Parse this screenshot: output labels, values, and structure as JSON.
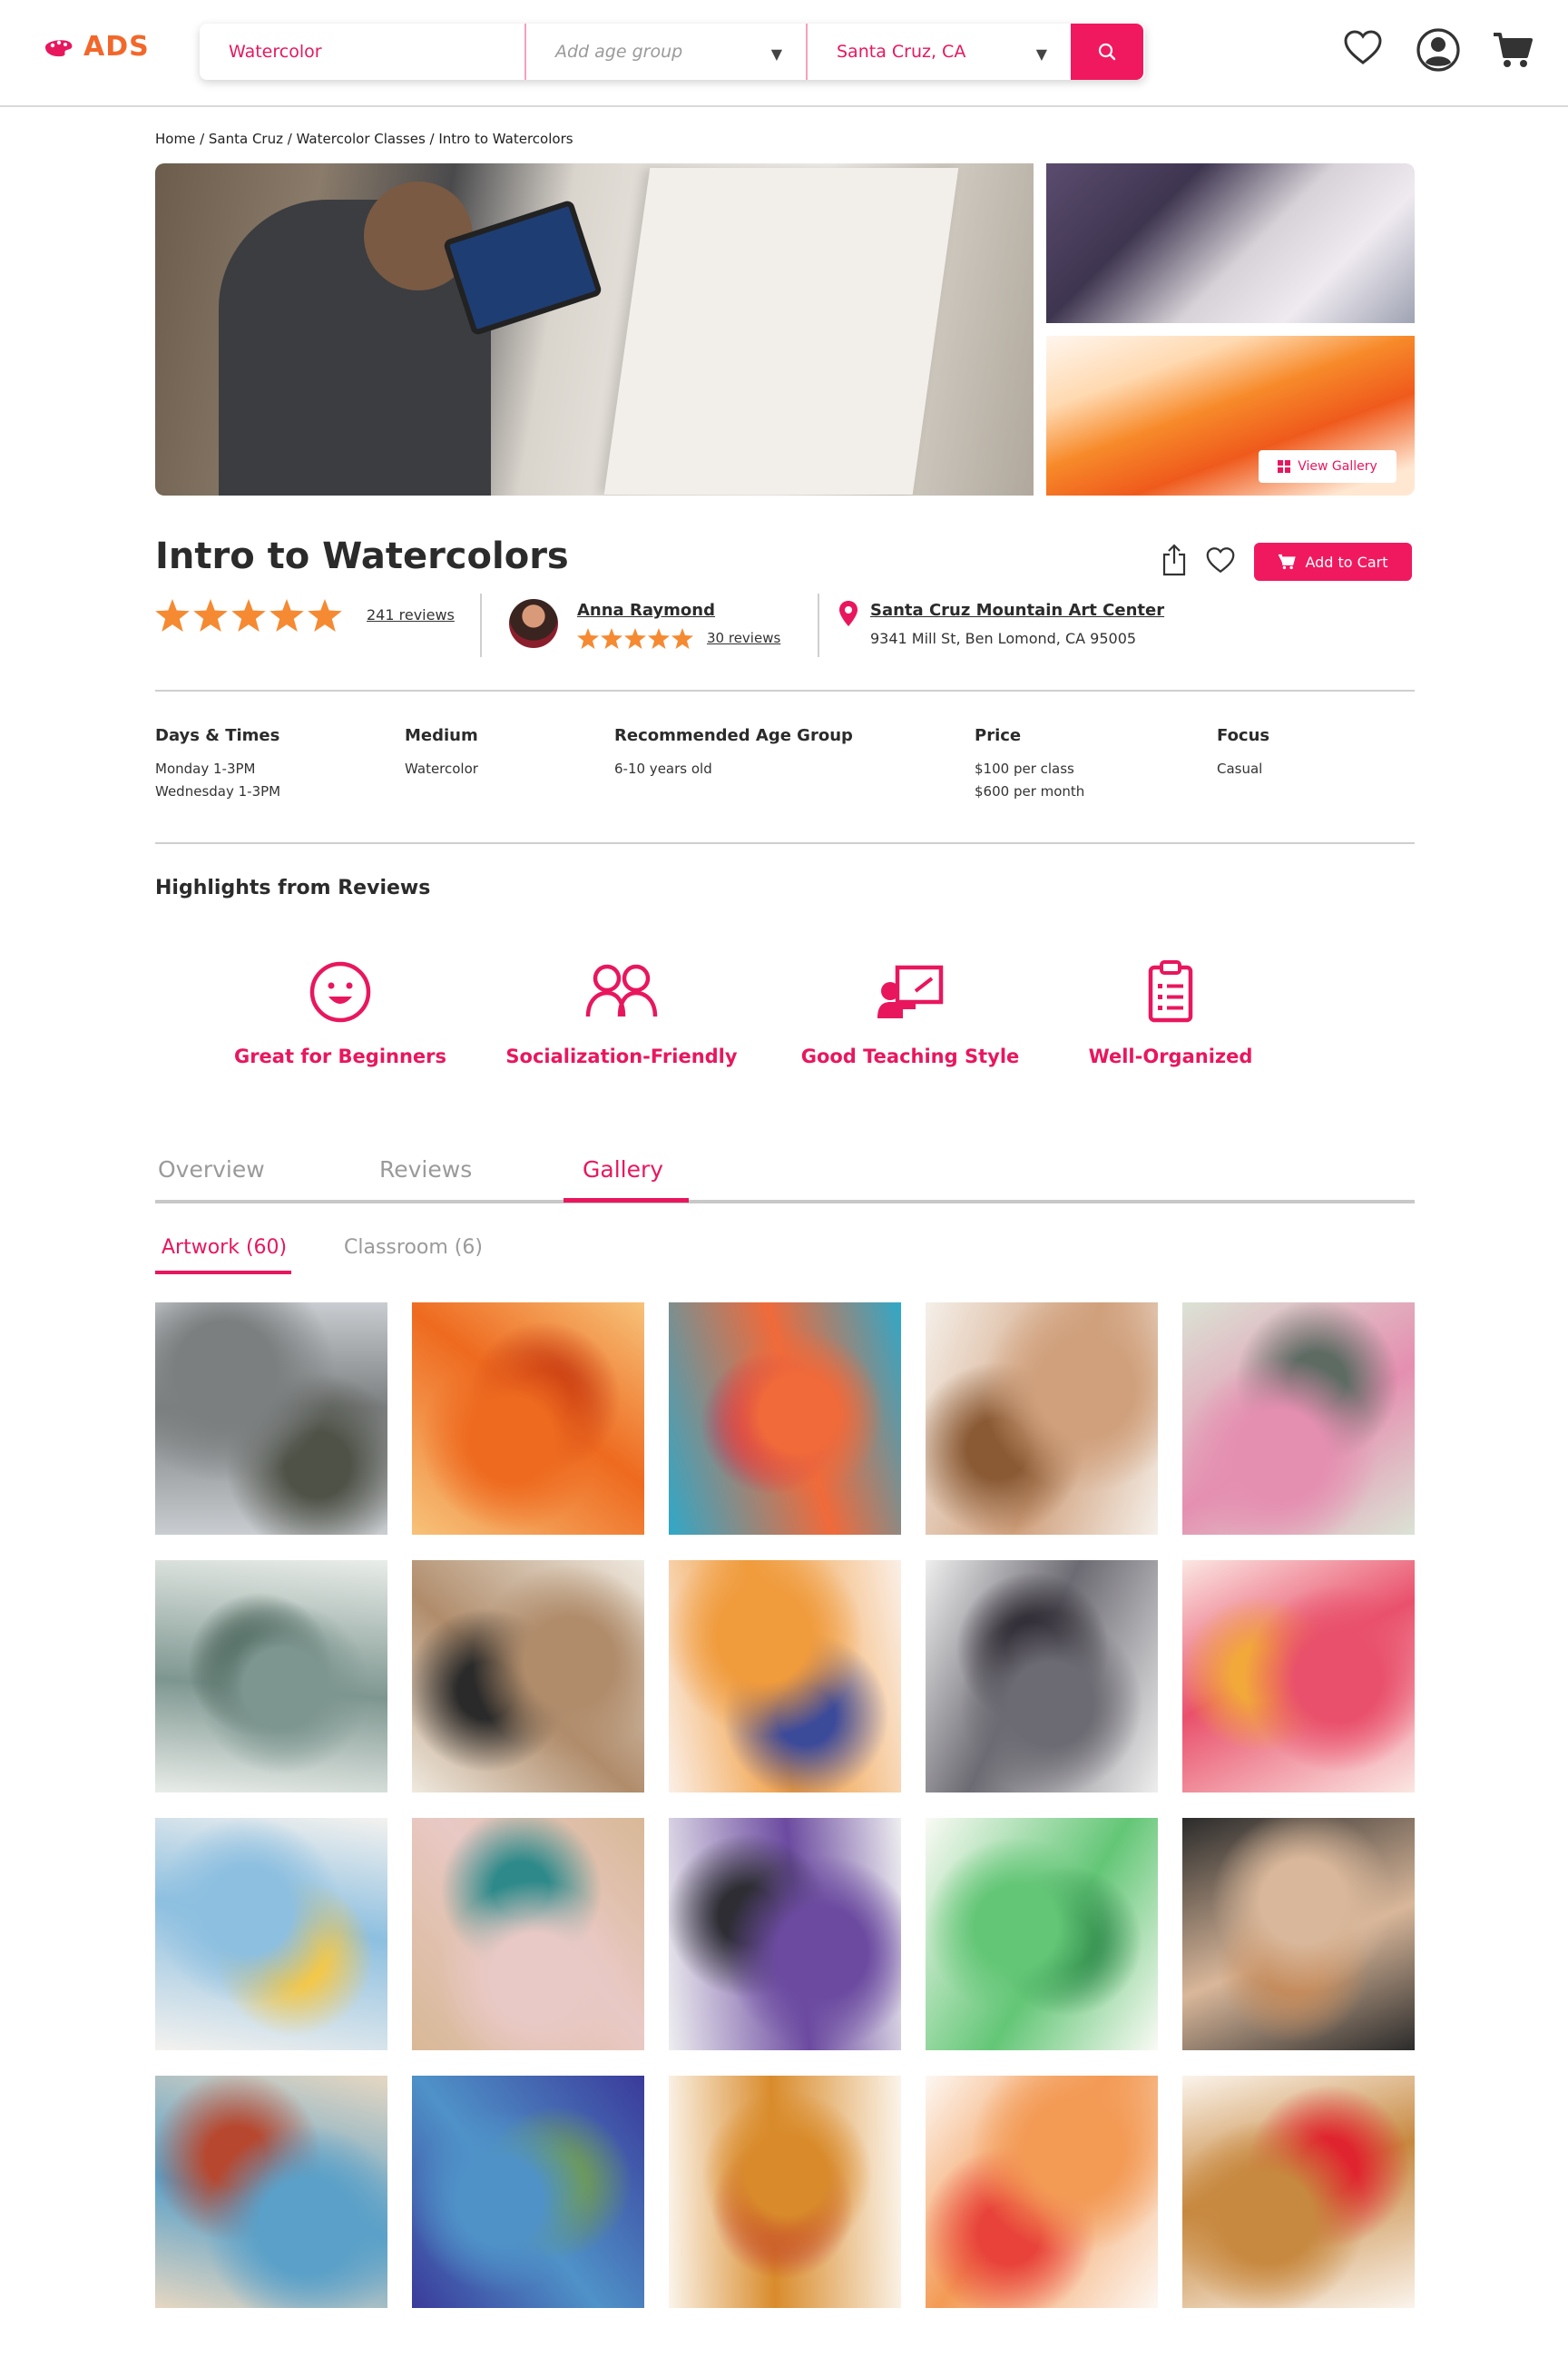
{
  "header": {
    "logo_text": "ADS",
    "search_query": "Watercolor",
    "age_placeholder": "Add age group",
    "location": "Santa Cruz, CA",
    "brand_color": "#f0195f",
    "logo_color": "#f2682a"
  },
  "breadcrumb": "Home / Santa Cruz / Watercolor Classes / Intro to Watercolors",
  "hero": {
    "view_gallery_label": "View Gallery"
  },
  "class": {
    "title": "Intro to Watercolors",
    "add_to_cart_label": "Add to Cart",
    "rating_stars": 5,
    "reviews_label": "241 reviews",
    "teacher_name": "Anna Raymond",
    "teacher_reviews_label": "30 reviews",
    "location_name": "Santa Cruz Mountain Art Center",
    "location_address": "9341 Mill St, Ben Lomond, CA 95005"
  },
  "details": [
    {
      "label": "Days & Times",
      "lines": [
        "Monday 1-3PM",
        "Wednesday 1-3PM"
      ]
    },
    {
      "label": "Medium",
      "lines": [
        "Watercolor"
      ]
    },
    {
      "label": "Recommended Age Group",
      "lines": [
        "6-10 years old"
      ]
    },
    {
      "label": "Price",
      "lines": [
        "$100 per class",
        "$600 per month"
      ]
    },
    {
      "label": "Focus",
      "lines": [
        "Casual"
      ]
    }
  ],
  "highlights": {
    "title": "Highlights from Reviews",
    "items": [
      {
        "label": "Great for Beginners",
        "icon": "smiley-icon"
      },
      {
        "label": "Socialization-Friendly",
        "icon": "people-icon"
      },
      {
        "label": "Good Teaching Style",
        "icon": "teacher-board-icon"
      },
      {
        "label": "Well-Organized",
        "icon": "clipboard-icon"
      }
    ]
  },
  "tabs": [
    {
      "label": "Overview",
      "active": false
    },
    {
      "label": "Reviews",
      "active": false
    },
    {
      "label": "Gallery",
      "active": true
    }
  ],
  "subtabs": [
    {
      "label": "Artwork (60)",
      "active": true
    },
    {
      "label": "Classroom (6)",
      "active": false
    }
  ],
  "gallery": [
    {
      "name": "misty-barn",
      "colors": [
        "#c9ccd0",
        "#7c7f80",
        "#4e5247"
      ]
    },
    {
      "name": "orange-fox",
      "colors": [
        "#f7c27a",
        "#ee6a1f",
        "#c83b12"
      ]
    },
    {
      "name": "fantasy-girl",
      "colors": [
        "#2fa8c8",
        "#f06a3a",
        "#c42a54"
      ]
    },
    {
      "name": "painting-hands",
      "colors": [
        "#f5f0ea",
        "#d0a07c",
        "#8a5a35"
      ]
    },
    {
      "name": "lotus-flower",
      "colors": [
        "#dbe3d5",
        "#e58fb0",
        "#5d6b63"
      ]
    },
    {
      "name": "pine-forest",
      "colors": [
        "#e9ede9",
        "#7e9690",
        "#2f4a3e"
      ]
    },
    {
      "name": "paint-supplies",
      "colors": [
        "#efe9df",
        "#b08c6b",
        "#2a2a2a"
      ]
    },
    {
      "name": "rainbow-cat",
      "colors": [
        "#fbefe7",
        "#f09b3c",
        "#3c4a9a"
      ]
    },
    {
      "name": "dark-flower",
      "colors": [
        "#eeeeee",
        "#6c6a72",
        "#2b2730"
      ]
    },
    {
      "name": "pink-hair-girl",
      "colors": [
        "#fbe7e3",
        "#e9506b",
        "#f2a93a"
      ]
    },
    {
      "name": "color-swatches",
      "colors": [
        "#f4f2ef",
        "#8dbfe0",
        "#f6c844"
      ]
    },
    {
      "name": "bird-painting",
      "colors": [
        "#d8b896",
        "#e9c9c5",
        "#2e8a8a"
      ]
    },
    {
      "name": "iris-sketch",
      "colors": [
        "#eeeef0",
        "#6b4aa0",
        "#2d2d33"
      ]
    },
    {
      "name": "green-creature",
      "colors": [
        "#fafaf5",
        "#63c676",
        "#2f8a4b"
      ]
    },
    {
      "name": "face-painting",
      "colors": [
        "#2b2b2b",
        "#d9b79a",
        "#c48b5c"
      ]
    },
    {
      "name": "palette-houses",
      "colors": [
        "#e6d7c2",
        "#5aa0c8",
        "#b7472e"
      ]
    },
    {
      "name": "earth-globe",
      "colors": [
        "#3a3a9a",
        "#4f92c8",
        "#6f9a55"
      ]
    },
    {
      "name": "hedgehog",
      "colors": [
        "#fbf4ea",
        "#d98b2b",
        "#c0392b"
      ]
    },
    {
      "name": "handprints",
      "colors": [
        "#fdf8f3",
        "#f39a55",
        "#e8423a"
      ]
    },
    {
      "name": "bear-bunny",
      "colors": [
        "#fbf4ec",
        "#c7883f",
        "#e0242f"
      ]
    }
  ]
}
